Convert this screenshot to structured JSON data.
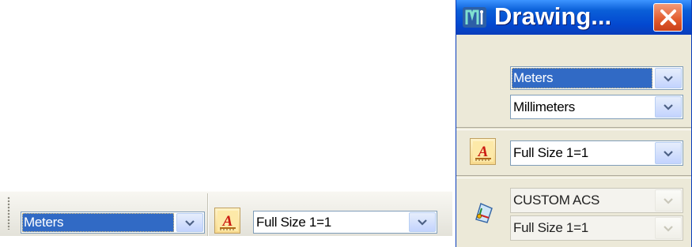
{
  "toolbar": {
    "working_units": "Meters",
    "annotation_scale": "Full Size 1=1"
  },
  "palette": {
    "title": "Drawing...",
    "master_units": "Meters",
    "sub_units": "Millimeters",
    "annotation_scale": "Full Size 1=1",
    "acs": "CUSTOM ACS",
    "acs_scale": "Full Size 1=1"
  },
  "icons": {
    "dropdown": "chevron-down-icon",
    "annotation": "annotation-scale-icon",
    "acs": "acs-icon",
    "close": "close-icon",
    "app": "app-icon"
  },
  "colors": {
    "selection": "#316ac5",
    "titlebar": "#0a5fd8",
    "close": "#e25a2c",
    "annotation_a": "#cc1b12"
  }
}
